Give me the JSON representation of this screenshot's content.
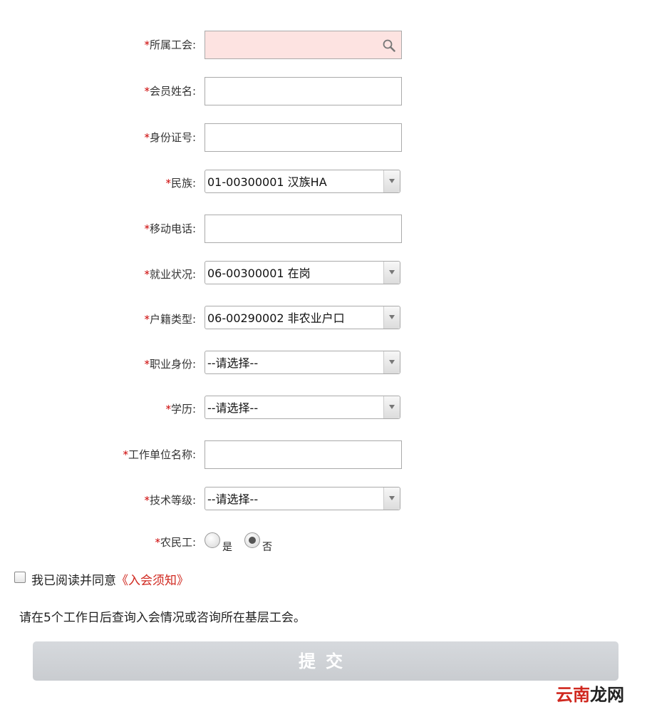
{
  "form": {
    "union": {
      "label": "所属工会:",
      "value": ""
    },
    "member_name": {
      "label": "会员姓名:",
      "value": ""
    },
    "id_number": {
      "label": "身份证号:",
      "value": ""
    },
    "ethnicity": {
      "label": "民族:",
      "selected": "01-00300001  汉族HA"
    },
    "mobile": {
      "label": "移动电话:",
      "value": ""
    },
    "employment": {
      "label": "就业状况:",
      "selected": "06-00300001  在岗"
    },
    "household": {
      "label": "户籍类型:",
      "selected": "06-00290002  非农业户口"
    },
    "occupation": {
      "label": "职业身份:",
      "selected": "--请选择--"
    },
    "education": {
      "label": "学历:",
      "selected": "--请选择--"
    },
    "employer": {
      "label": "工作单位名称:",
      "value": ""
    },
    "skill_level": {
      "label": "技术等级:",
      "selected": "--请选择--"
    },
    "migrant_worker": {
      "label": "农民工:",
      "options": [
        "是",
        "否"
      ],
      "selected": "否"
    },
    "required_mark": "*"
  },
  "agreement": {
    "text": "我已阅读并同意",
    "link": "《入会须知》",
    "checked": false
  },
  "notice": "请在5个工作日后查询入会情况或咨询所在基层工会。",
  "submit_label": "提交",
  "watermark": {
    "part1": "云南",
    "part2": "龙网"
  },
  "colors": {
    "required": "#cc0000",
    "link": "#d0281f",
    "highlight_input": "#fde3e1"
  }
}
